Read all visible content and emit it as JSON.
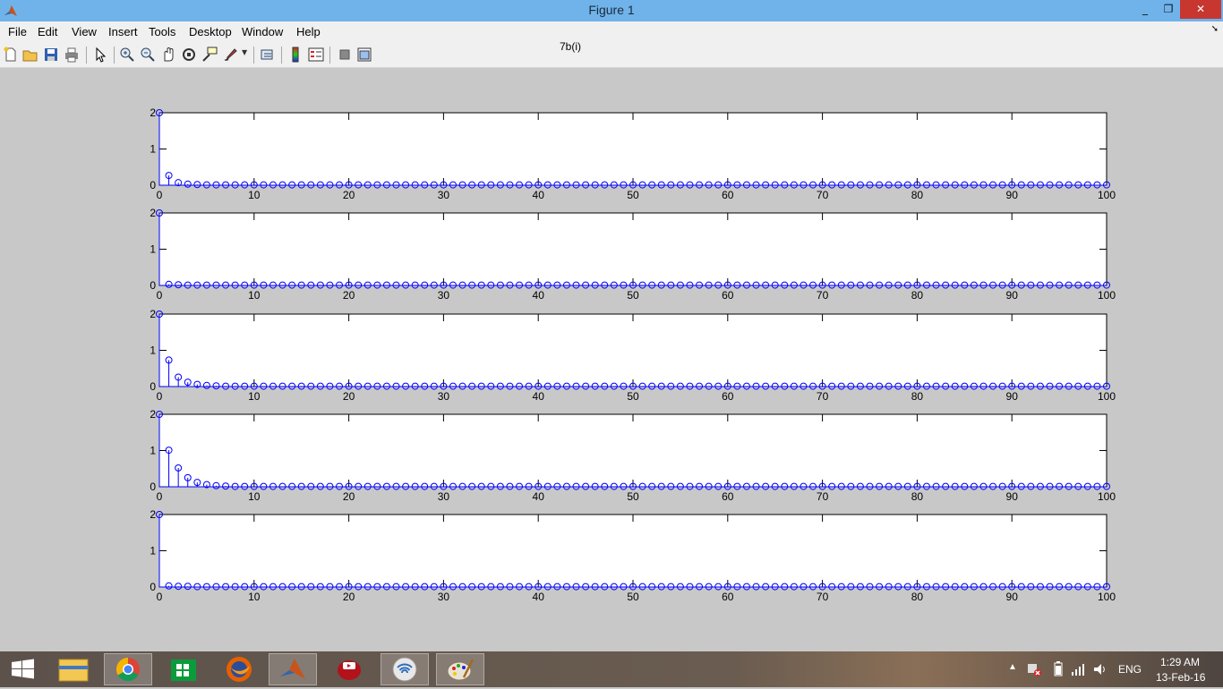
{
  "window": {
    "title": "Figure 1",
    "minimize": "_",
    "maximize": "❐",
    "close": "✕"
  },
  "menu": [
    "File",
    "Edit",
    "View",
    "Insert",
    "Tools",
    "Desktop",
    "Window",
    "Help"
  ],
  "toolbar": {
    "buttons": [
      "new-figure-icon",
      "open-file-icon",
      "save-icon",
      "print-icon",
      "edit-plot-arrow-icon",
      "zoom-in-icon",
      "zoom-out-icon",
      "pan-hand-icon",
      "rotate-3d-icon",
      "data-cursor-icon",
      "brush-icon",
      "link-plot-icon",
      "insert-colorbar-icon",
      "insert-legend-icon",
      "hide-plot-tools-icon",
      "show-plot-tools-icon"
    ]
  },
  "figure": {
    "title": "7b(i)"
  },
  "chart_data": [
    {
      "type": "stem",
      "x": [
        0,
        100
      ],
      "xticks": [
        "0",
        "10",
        "20",
        "30",
        "40",
        "50",
        "60",
        "70",
        "80",
        "90",
        "100"
      ],
      "yticks": [
        "0",
        "1",
        "2"
      ],
      "ylim": [
        0,
        2
      ],
      "values": [
        2,
        0.27,
        0.07,
        0.03,
        0.02,
        0.01,
        0.01,
        0.01,
        0.01,
        0.01
      ]
    },
    {
      "type": "stem",
      "x": [
        0,
        100
      ],
      "xticks": [
        "0",
        "10",
        "20",
        "30",
        "40",
        "50",
        "60",
        "70",
        "80",
        "90",
        "100"
      ],
      "yticks": [
        "0",
        "1",
        "2"
      ],
      "ylim": [
        0,
        2
      ],
      "values": [
        2,
        0.03,
        0.02,
        0.01,
        0.01,
        0.01,
        0.01,
        0.01,
        0.01,
        0.01
      ]
    },
    {
      "type": "stem",
      "x": [
        0,
        100
      ],
      "xticks": [
        "0",
        "10",
        "20",
        "30",
        "40",
        "50",
        "60",
        "70",
        "80",
        "90",
        "100"
      ],
      "yticks": [
        "0",
        "1",
        "2"
      ],
      "ylim": [
        0,
        2
      ],
      "values": [
        2,
        0.73,
        0.26,
        0.12,
        0.06,
        0.03,
        0.02,
        0.01,
        0.01,
        0.01
      ]
    },
    {
      "type": "stem",
      "x": [
        0,
        100
      ],
      "xticks": [
        "0",
        "10",
        "20",
        "30",
        "40",
        "50",
        "60",
        "70",
        "80",
        "90",
        "100"
      ],
      "yticks": [
        "0",
        "1",
        "2"
      ],
      "ylim": [
        0,
        2
      ],
      "values": [
        2,
        1.01,
        0.52,
        0.25,
        0.12,
        0.06,
        0.03,
        0.02,
        0.01,
        0.01
      ]
    },
    {
      "type": "stem",
      "x": [
        0,
        100
      ],
      "xticks": [
        "0",
        "10",
        "20",
        "30",
        "40",
        "50",
        "60",
        "70",
        "80",
        "90",
        "100"
      ],
      "yticks": [
        "0",
        "1",
        "2"
      ],
      "ylim": [
        0,
        2
      ],
      "values": [
        2,
        0.03,
        0.02,
        0.02,
        0.01,
        0.01,
        0.01,
        0.01,
        0.01,
        0.01
      ]
    }
  ],
  "colors": {
    "stem": "#0000ff",
    "titlebar": "#6fb3ea",
    "close": "#c7372f",
    "figure_bg": "#c8c8c8"
  },
  "taskbar": {
    "apps": [
      "windows-start-icon",
      "file-explorer-icon",
      "chrome-icon",
      "store-icon",
      "firefox-icon",
      "matlab-icon",
      "media-player-icon",
      "wifi-share-icon",
      "paint-icon"
    ],
    "tray": {
      "lang": "ENG",
      "time": "1:29 AM",
      "date": "13-Feb-16"
    }
  }
}
